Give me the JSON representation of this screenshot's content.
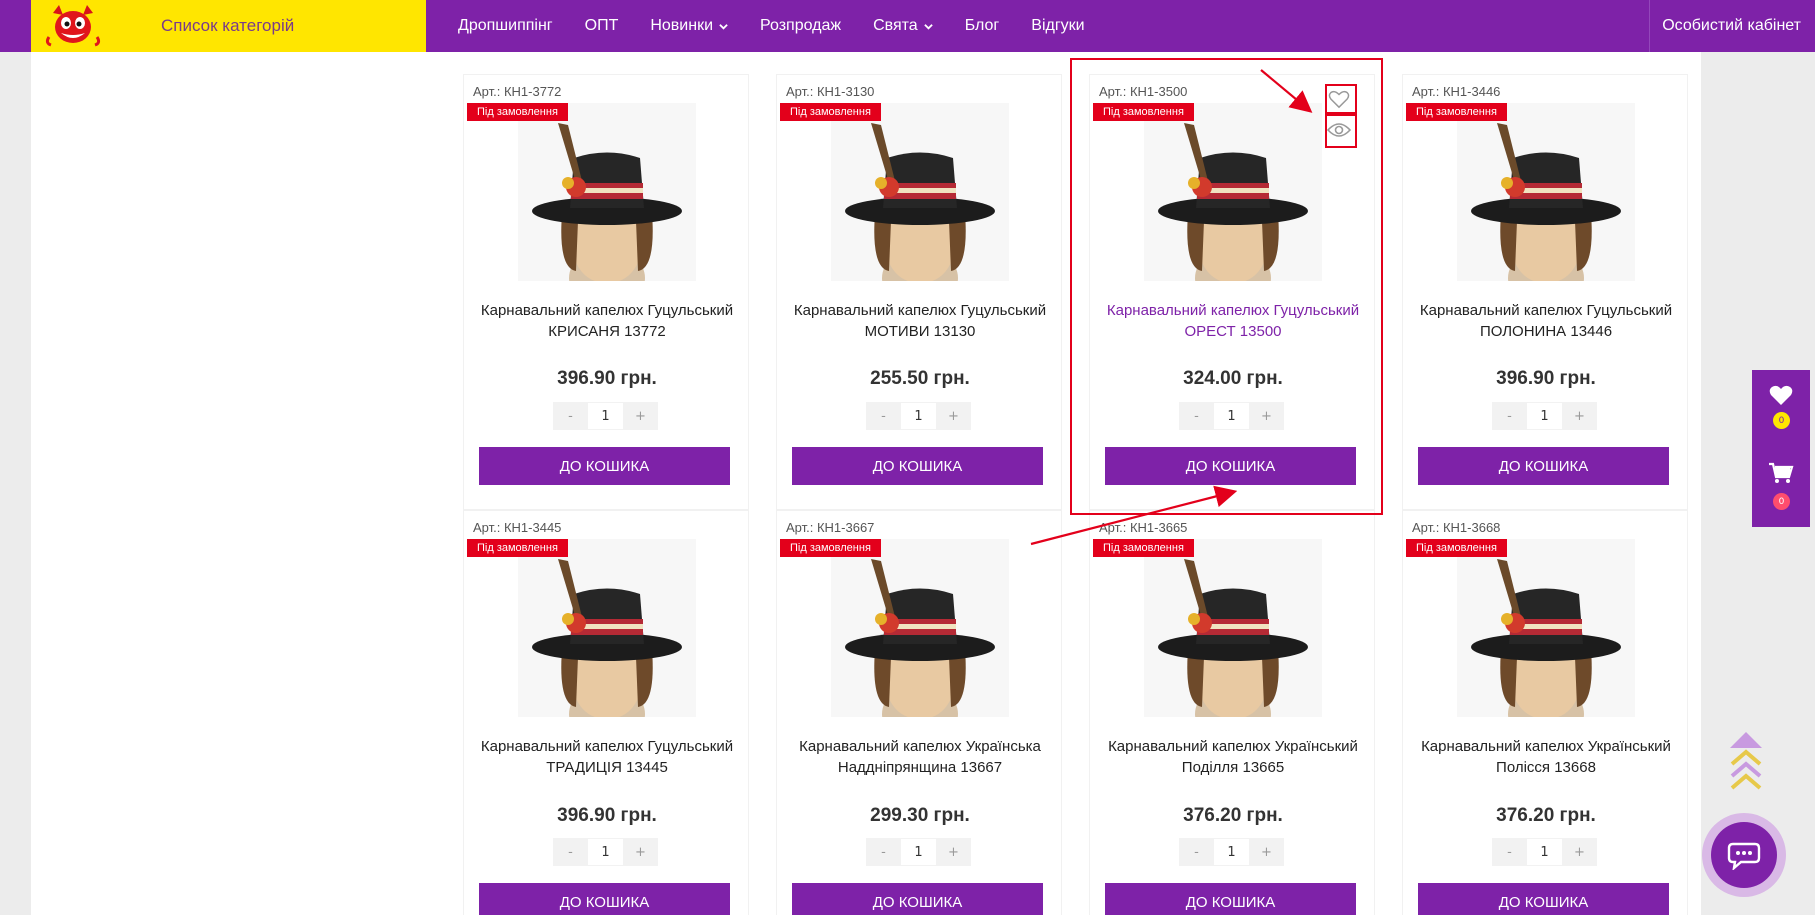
{
  "header": {
    "categories_label": "Список категорій",
    "nav": [
      {
        "label": "Дропшиппінг"
      },
      {
        "label": "ОПТ"
      },
      {
        "label": "Новинки"
      },
      {
        "label": "Розпродаж"
      },
      {
        "label": "Свята"
      },
      {
        "label": "Блог"
      },
      {
        "label": "Відгуки"
      }
    ],
    "cabinet_label": "Особистий кабінет"
  },
  "products": [
    {
      "sku": "Арт.: КН1-3772",
      "badge": "Під замовлення",
      "title": "Карнавальний капелюх Гуцульський КРИСАНЯ 13772",
      "price": "396.90 грн.",
      "qty": "1",
      "buy_label": "ДО КОШИКА",
      "minus": "-",
      "plus": "+"
    },
    {
      "sku": "Арт.: КН1-3130",
      "badge": "Під замовлення",
      "title": "Карнавальний капелюх Гуцульський МОТИВИ 13130",
      "price": "255.50 грн.",
      "qty": "1",
      "buy_label": "ДО КОШИКА",
      "minus": "-",
      "plus": "+"
    },
    {
      "sku": "Арт.: КН1-3500",
      "badge": "Під замовлення",
      "title": "Карнавальний капелюх Гуцульський ОРЕСТ 13500",
      "price": "324.00 грн.",
      "qty": "1",
      "buy_label": "ДО КОШИКА",
      "minus": "-",
      "plus": "+"
    },
    {
      "sku": "Арт.: КН1-3446",
      "badge": "Під замовлення",
      "title": "Карнавальний капелюх Гуцульський ПОЛОНИНА 13446",
      "price": "396.90 грн.",
      "qty": "1",
      "buy_label": "ДО КОШИКА",
      "minus": "-",
      "plus": "+"
    },
    {
      "sku": "Арт.: КН1-3445",
      "badge": "Під замовлення",
      "title": "Карнавальний капелюх Гуцульський ТРАДИЦІЯ 13445",
      "price": "396.90 грн.",
      "qty": "1",
      "buy_label": "ДО КОШИКА",
      "minus": "-",
      "plus": "+"
    },
    {
      "sku": "Арт.: КН1-3667",
      "badge": "Під замовлення",
      "title": "Карнавальний капелюх Українська Наддніпрянщина 13667",
      "price": "299.30 грн.",
      "qty": "1",
      "buy_label": "ДО КОШИКА",
      "minus": "-",
      "plus": "+"
    },
    {
      "sku": "Арт.: КН1-3665",
      "badge": "Під замовлення",
      "title": "Карнавальний капелюх Український Поділля 13665",
      "price": "376.20 грн.",
      "qty": "1",
      "buy_label": "ДО КОШИКА",
      "minus": "-",
      "plus": "+"
    },
    {
      "sku": "Арт.: КН1-3668",
      "badge": "Під замовлення",
      "title": "Карнавальний капелюх Український Полісся 13668",
      "price": "376.20 грн.",
      "qty": "1",
      "buy_label": "ДО КОШИКА",
      "minus": "-",
      "plus": "+"
    }
  ],
  "side": {
    "wishlist_count": "0",
    "cart_count": "0"
  },
  "colors": {
    "brand": "#7e22a8",
    "yellow": "#ffe600",
    "badge": "#e3001b",
    "annotation": "#e3001b"
  },
  "icons": [
    "devil-logo-icon",
    "chevron-down-icon",
    "heart-icon",
    "eye-icon",
    "cart-icon",
    "arrow-up-icon",
    "chat-icon"
  ]
}
